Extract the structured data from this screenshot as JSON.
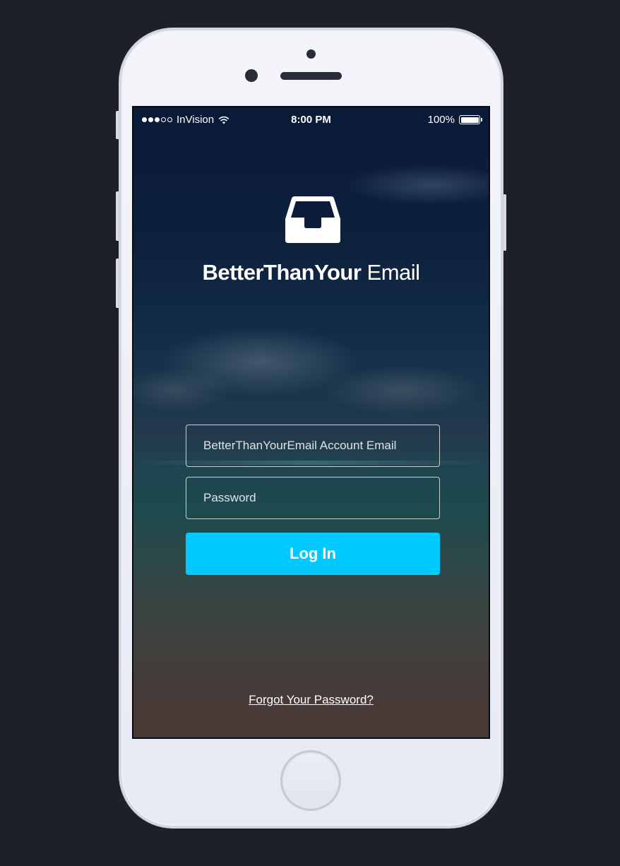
{
  "status_bar": {
    "carrier": "InVision",
    "time": "8:00 PM",
    "battery": "100%",
    "signal_bars_filled": 3,
    "signal_bars_total": 5,
    "icons": [
      "wifi-icon",
      "battery-icon"
    ]
  },
  "brand": {
    "name_bold": "BetterThanYour",
    "name_light": "Email",
    "icon": "inbox-tray-icon"
  },
  "form": {
    "email_placeholder": "BetterThanYourEmail Account Email",
    "email_value": "",
    "password_placeholder": "Password",
    "password_value": "",
    "login_label": "Log In",
    "forgot_label": "Forgot Your Password?"
  },
  "colors": {
    "page_background": "#1d1f29",
    "phone_body": "#eef0f7",
    "accent_button": "#00c9ff",
    "text": "#ffffff"
  }
}
